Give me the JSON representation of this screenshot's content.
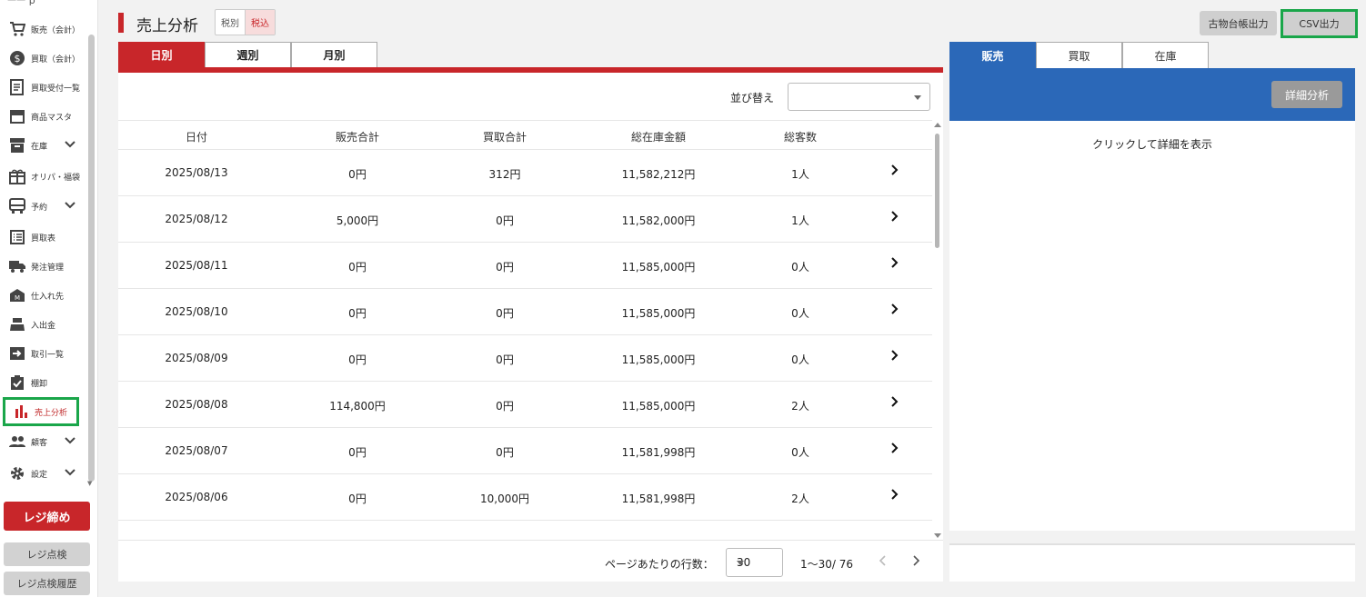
{
  "sidebar": {
    "top_fragment": "ㅡㅡ p",
    "items": [
      {
        "label": "販売（会計）",
        "icon": "cart-icon"
      },
      {
        "label": "買取（会計）",
        "icon": "dollar-circle-icon"
      },
      {
        "label": "買取受付一覧",
        "icon": "receipt-icon"
      },
      {
        "label": "商品マスタ",
        "icon": "store-icon"
      },
      {
        "label": "在庫",
        "icon": "inventory-icon"
      },
      {
        "label": "オリパ・福袋",
        "icon": "gift-icon"
      },
      {
        "label": "予約",
        "icon": "bus-icon"
      },
      {
        "label": "買取表",
        "icon": "list-icon"
      },
      {
        "label": "発注管理",
        "icon": "truck-icon"
      },
      {
        "label": "仕入れ先",
        "icon": "warehouse-icon"
      },
      {
        "label": "入出金",
        "icon": "register-icon"
      },
      {
        "label": "取引一覧",
        "icon": "arrow-box-icon"
      },
      {
        "label": "棚卸",
        "icon": "clipboard-check-icon"
      },
      {
        "label": "売上分析",
        "icon": "bar-chart-icon"
      },
      {
        "label": "顧客",
        "icon": "people-icon"
      },
      {
        "label": "設定",
        "icon": "gear-icon"
      }
    ],
    "close_register": "レジ締め",
    "register_check": "レジ点検",
    "register_check_history": "レジ点検履歴"
  },
  "header": {
    "title": "売上分析",
    "tax_excluded": "税別",
    "tax_included": "税込",
    "ledger_button": "古物台帳出力",
    "csv_button": "CSV出力"
  },
  "tabs": [
    "日別",
    "週別",
    "月別"
  ],
  "sort": {
    "label": "並び替え",
    "value": ""
  },
  "table": {
    "headers": [
      "日付",
      "販売合計",
      "買取合計",
      "総在庫金額",
      "総客数"
    ],
    "rows": [
      [
        "2025/08/13",
        "0円",
        "312円",
        "11,582,212円",
        "1人"
      ],
      [
        "2025/08/12",
        "5,000円",
        "0円",
        "11,582,000円",
        "1人"
      ],
      [
        "2025/08/11",
        "0円",
        "0円",
        "11,585,000円",
        "0人"
      ],
      [
        "2025/08/10",
        "0円",
        "0円",
        "11,585,000円",
        "0人"
      ],
      [
        "2025/08/09",
        "0円",
        "0円",
        "11,585,000円",
        "0人"
      ],
      [
        "2025/08/08",
        "114,800円",
        "0円",
        "11,585,000円",
        "2人"
      ],
      [
        "2025/08/07",
        "0円",
        "0円",
        "11,581,998円",
        "0人"
      ],
      [
        "2025/08/06",
        "0円",
        "10,000円",
        "11,581,998円",
        "2人"
      ]
    ]
  },
  "pagination": {
    "rows_per_page_label": "ページあたりの行数：",
    "rows_per_page": "30",
    "range": "1〜30/ 76"
  },
  "right": {
    "tabs": [
      "販売",
      "買取",
      "在庫"
    ],
    "detail_button": "詳細分析",
    "hint": "クリックして詳細を表示"
  },
  "colors": {
    "accent_red": "#c8262a",
    "accent_blue": "#2b68b8",
    "highlight_green": "#1aa64a"
  }
}
